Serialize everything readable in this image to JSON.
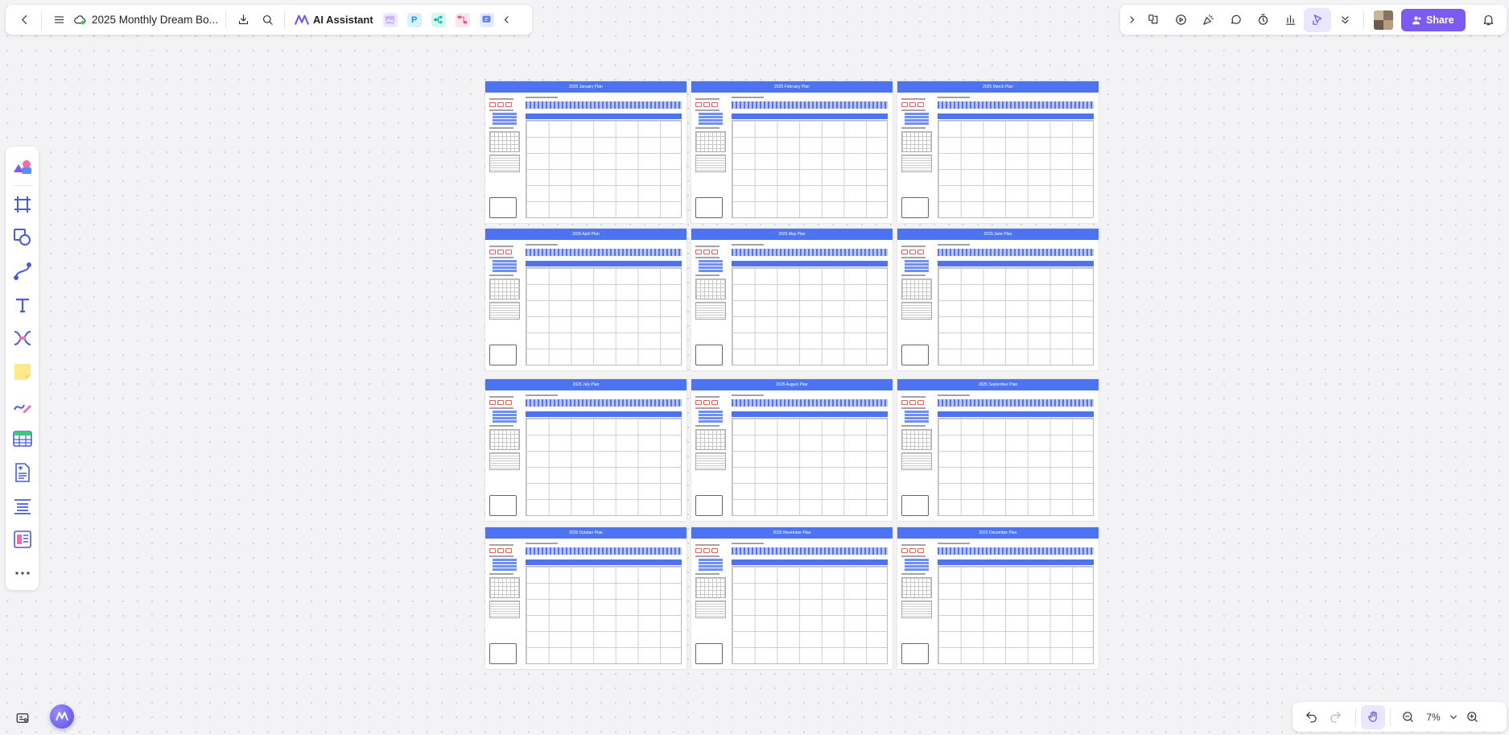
{
  "toolbar": {
    "document_title": "2025 Monthly Dream Bo...",
    "ai_assistant_label": "AI Assistant",
    "share_label": "Share",
    "app_icons": [
      {
        "name": "image-gen-icon",
        "color": "#a98cf5",
        "bg": "#efe9ff",
        "glyph": ""
      },
      {
        "name": "presentation-app-icon",
        "color": "#1e88e5",
        "bg": "#d9f1ff",
        "glyph": "P"
      },
      {
        "name": "mindmap-app-icon",
        "color": "#11b5a4",
        "bg": "#d5f7f1",
        "glyph": ""
      },
      {
        "name": "flowchart-app-icon",
        "color": "#e5538a",
        "bg": "#ffe3ee",
        "glyph": ""
      },
      {
        "name": "chat-app-icon",
        "color": "#5b7cf0",
        "bg": "#e4eaff",
        "glyph": ""
      }
    ]
  },
  "zoom": {
    "level": "7%"
  },
  "colors": {
    "accent": "#7c5cf0",
    "page_header": "#4d73f0"
  },
  "pages": [
    {
      "title": "2025 January Plan"
    },
    {
      "title": "2025 February Plan"
    },
    {
      "title": "2025 March Plan"
    },
    {
      "title": "2025 April Plan"
    },
    {
      "title": "2025 May Plan"
    },
    {
      "title": "2025 June Plan"
    },
    {
      "title": "2025 July Plan"
    },
    {
      "title": "2025 August Plan"
    },
    {
      "title": "2025 September Plan"
    },
    {
      "title": "2025 October Plan"
    },
    {
      "title": "2025 November Plan"
    },
    {
      "title": "2025 December Plan"
    }
  ]
}
